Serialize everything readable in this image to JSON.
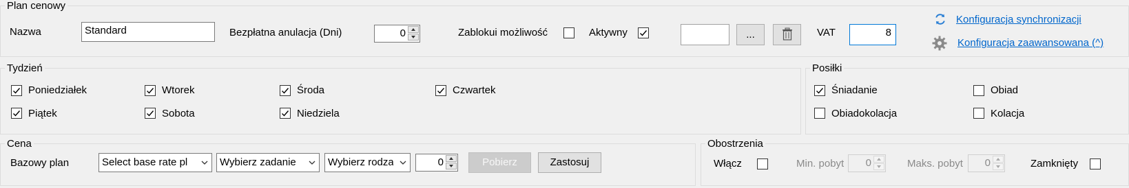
{
  "plan": {
    "legend": "Plan cenowy",
    "name_label": "Nazwa",
    "name_value": "Standard",
    "free_cancel_label": "Bezpłatna anulacja (Dni)",
    "free_cancel_value": "0",
    "block_label": "Zablokui możliwość",
    "active_label": "Aktywny",
    "browse_label": "...",
    "vat_label": "VAT",
    "vat_value": "8",
    "sync_link": "Konfiguracja synchronizacji",
    "advanced_link": "Konfiguracja zaawansowana (^)"
  },
  "week": {
    "legend": "Tydzień",
    "days": [
      "Poniedziałek",
      "Wtorek",
      "Środa",
      "Czwartek",
      "Piątek",
      "Sobota",
      "Niedziela"
    ]
  },
  "meals": {
    "legend": "Posiłki",
    "items": [
      "Śniadanie",
      "Obiad",
      "Obiadokolacja",
      "Kolacja"
    ]
  },
  "price": {
    "legend": "Cena",
    "base_label": "Bazowy plan",
    "base_select": "Select base rate pl",
    "task_select": "Wybierz zadanie",
    "type_select": "Wybierz rodzaj",
    "number_value": "0",
    "fetch_label": "Pobierz",
    "apply_label": "Zastosuj"
  },
  "restrictions": {
    "legend": "Obostrzenia",
    "enable_label": "Włącz",
    "min_label": "Min. pobyt",
    "min_value": "0",
    "max_label": "Maks. pobyt",
    "max_value": "0",
    "closed_label": "Zamknięty"
  },
  "colors": {
    "link": "#0066cc",
    "focus_border": "#0078d7",
    "panel_bg": "#f0f0f0"
  }
}
